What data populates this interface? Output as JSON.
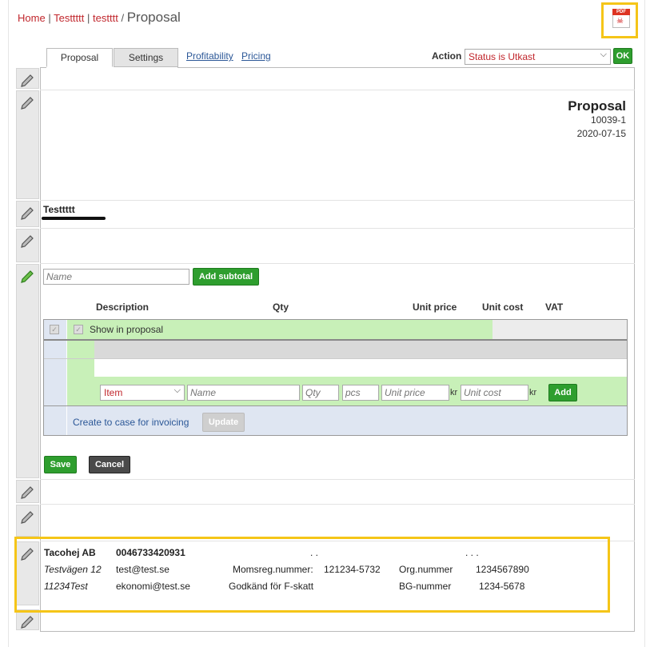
{
  "breadcrumb": {
    "home": "Home",
    "c1": "Testtttt",
    "c2": "testttt",
    "sep": "|",
    "slash": "/",
    "current": "Proposal"
  },
  "pdf_icon": {
    "icon": "pdf-file-icon",
    "label": "PDF"
  },
  "tabs": [
    {
      "label": "Proposal",
      "active": true
    },
    {
      "label": "Settings",
      "active": false
    }
  ],
  "links": [
    "Profitability",
    "Pricing"
  ],
  "action": {
    "label": "Action",
    "selected": "Status is Utkast",
    "ok_label": "OK"
  },
  "doc": {
    "title": "Proposal",
    "number": "10039-1",
    "date": "2020-07-15"
  },
  "customer": {
    "name": "Testtttt"
  },
  "subtotal": {
    "name_placeholder": "Name",
    "add_label": "Add subtotal"
  },
  "table": {
    "headers": [
      "Description",
      "Qty",
      "Unit price",
      "Unit cost",
      "VAT"
    ],
    "show_in_proposal": "Show in proposal",
    "row_type": "Item",
    "placeholders": {
      "name": "Name",
      "qty": "Qty",
      "unit": "pcs",
      "unit_price": "Unit price",
      "unit_cost": "Unit cost"
    },
    "currency": "kr",
    "add_label": "Add",
    "create_case_label": "Create to case for invoicing",
    "update_label": "Update"
  },
  "buttons": {
    "save": "Save",
    "cancel": "Cancel"
  },
  "footer": {
    "company": "Tacohej AB",
    "phone": "0046733420931",
    "street": "Testvägen 12",
    "zip_city": "11234Test",
    "email1": "test@test.se",
    "email2": "ekonomi@test.se",
    "vat_label": "Momsreg.nummer:",
    "vat_value": "121234-5732",
    "fskatt": "Godkänd för F-skatt",
    "org_label": "Org.nummer",
    "org_value": "1234567890",
    "bg_label": "BG-nummer",
    "bg_value": "1234-5678",
    "dots1": ". .",
    "dots2": ". . ."
  },
  "colors": {
    "brand_red": "#c1272d",
    "link_blue": "#2b5797",
    "green": "#2e9e2e",
    "highlight": "#f5c518",
    "row_green": "#c8f0b8"
  }
}
